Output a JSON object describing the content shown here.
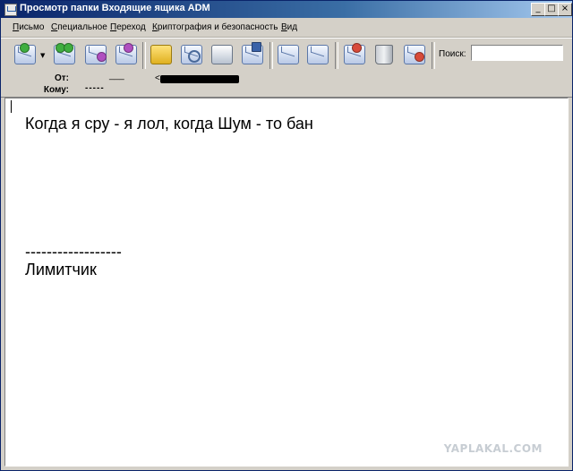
{
  "window": {
    "title": "Просмотр папки Входящие ящика ADM",
    "minimize_glyph": "_",
    "maximize_glyph": "□",
    "close_glyph": "×"
  },
  "menu": {
    "items": [
      "Письмо",
      "Специальное",
      "Переход",
      "Криптография и безопасность",
      "Вид"
    ]
  },
  "toolbar": {
    "buttons": [
      {
        "icon": "receive-mail-icon"
      },
      {
        "icon": "receive-all-icon"
      },
      {
        "icon": "reply-icon"
      },
      {
        "icon": "forward-icon"
      },
      {
        "icon": "address-book-icon"
      },
      {
        "icon": "find-icon"
      },
      {
        "icon": "print-icon"
      },
      {
        "icon": "save-icon"
      },
      {
        "icon": "previous-message-icon"
      },
      {
        "icon": "next-message-icon"
      },
      {
        "icon": "mark-delete-icon"
      },
      {
        "icon": "trash-icon"
      },
      {
        "icon": "delete-message-icon"
      }
    ],
    "dropdown_glyph": "▼",
    "search_label": "Поиск:",
    "search_value": ""
  },
  "header": {
    "from_label": "От:",
    "from_value_prefix": "___",
    "from_value_bracket": "<",
    "to_label": "Кому:",
    "to_value": "-----"
  },
  "message": {
    "line1": "Когда я сру - я лол, когда Шум - то бан",
    "separator": "------------------",
    "signature": "Лимитчик"
  },
  "watermark": "YAPLAKAL.COM"
}
